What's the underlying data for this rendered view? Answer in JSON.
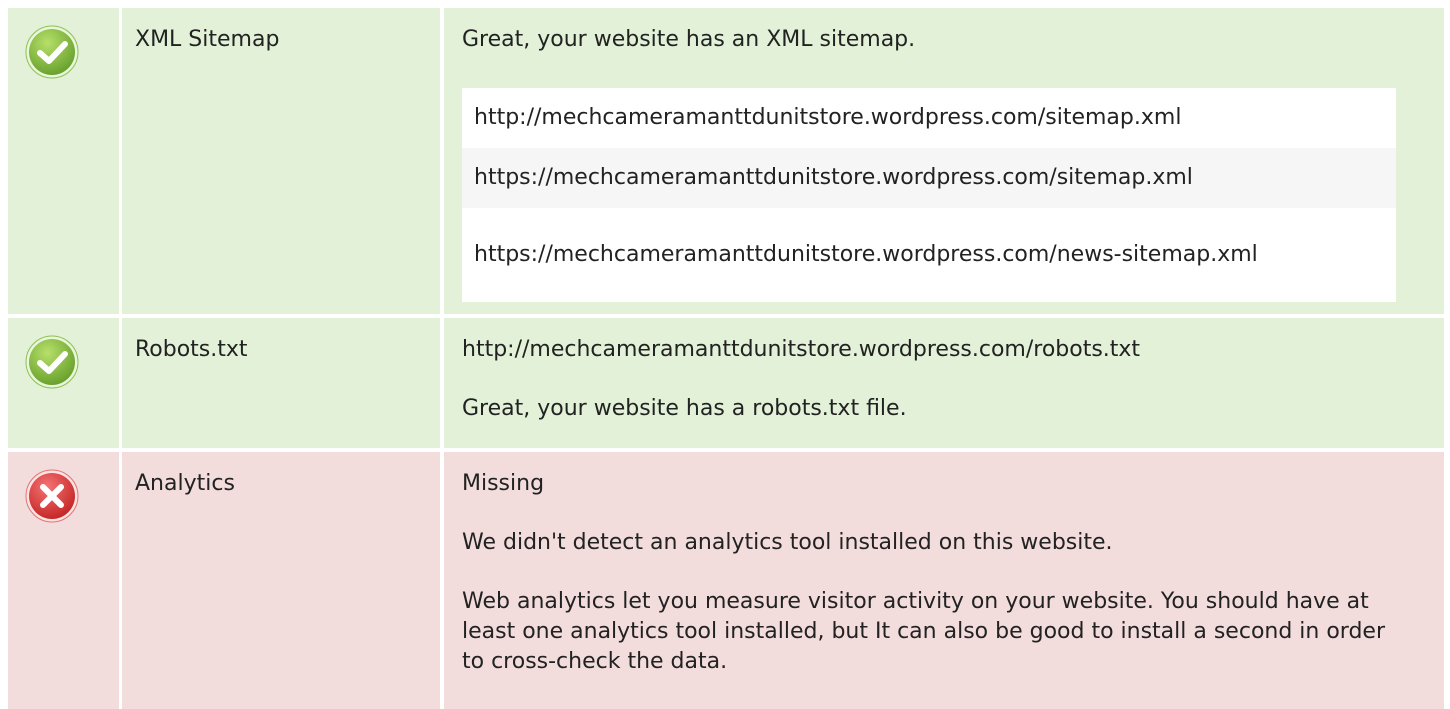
{
  "rows": [
    {
      "status": "pass",
      "label": "XML Sitemap",
      "message": "Great, your website has an XML sitemap.",
      "urls": [
        "http://mechcameramanttdunitstore.wordpress.com/sitemap.xml",
        "https://mechcameramanttdunitstore.wordpress.com/sitemap.xml",
        "https://mechcameramanttdunitstore.wordpress.com/news-sitemap.xml"
      ]
    },
    {
      "status": "pass",
      "label": "Robots.txt",
      "url": "http://mechcameramanttdunitstore.wordpress.com/robots.txt",
      "message": "Great, your website has a robots.txt file."
    },
    {
      "status": "fail",
      "label": "Analytics",
      "status_text": "Missing",
      "message": "We didn't detect an analytics tool installed on this website.",
      "detail": "Web analytics let you measure visitor activity on your website. You should have at least one analytics tool installed, but It can also be good to install a second in order to cross-check the data."
    }
  ],
  "colors": {
    "pass_bg": "#e2f1d8",
    "fail_bg": "#f2dcdc",
    "pass_icon": "#7cb342",
    "fail_icon": "#e53935"
  },
  "icons": {
    "pass": "check-circle-icon",
    "fail": "x-circle-icon"
  }
}
